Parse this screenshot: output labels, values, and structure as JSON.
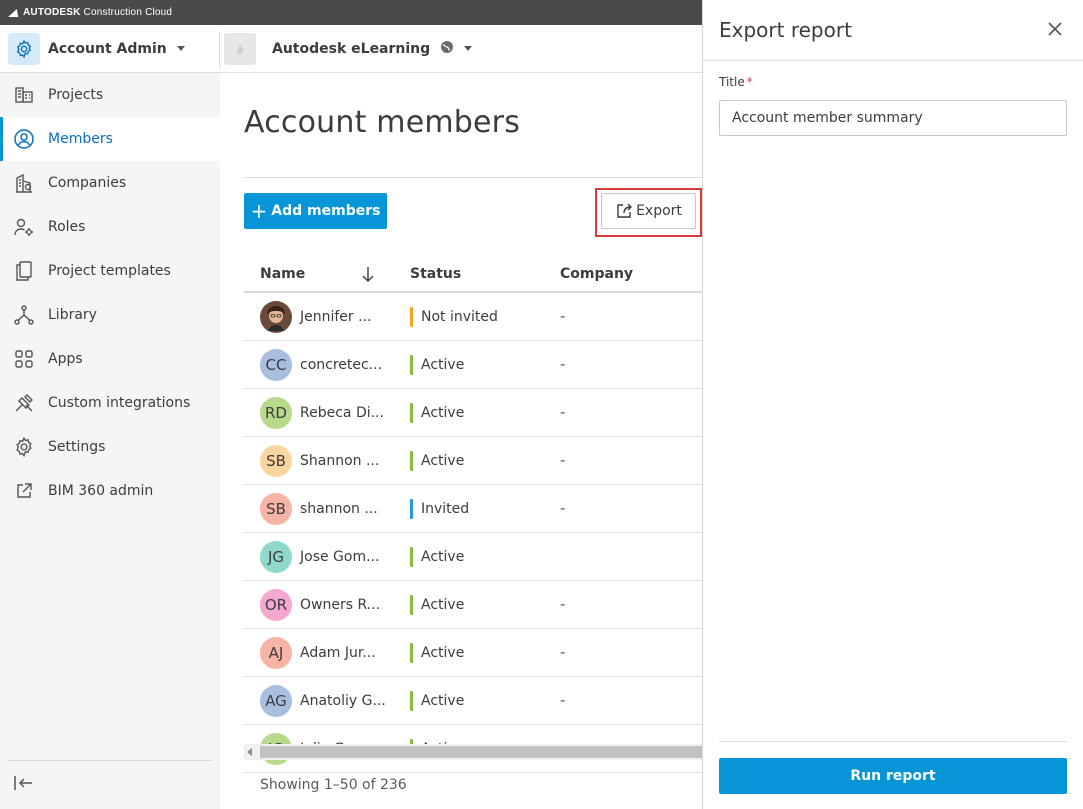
{
  "brand": {
    "name_bold": "AUTODESK",
    "name_rest": "Construction Cloud"
  },
  "header": {
    "account_label": "Account Admin",
    "project_label": "Autodesk eLearning"
  },
  "sidebar": {
    "items": [
      {
        "label": "Projects",
        "icon": "projects-icon"
      },
      {
        "label": "Members",
        "icon": "members-icon",
        "active": true
      },
      {
        "label": "Companies",
        "icon": "companies-icon"
      },
      {
        "label": "Roles",
        "icon": "roles-icon"
      },
      {
        "label": "Project templates",
        "icon": "templates-icon"
      },
      {
        "label": "Library",
        "icon": "library-icon"
      },
      {
        "label": "Apps",
        "icon": "apps-icon"
      },
      {
        "label": "Custom integrations",
        "icon": "integrations-icon"
      },
      {
        "label": "Settings",
        "icon": "settings-icon"
      },
      {
        "label": "BIM 360 admin",
        "icon": "external-link-icon"
      }
    ]
  },
  "main": {
    "title": "Account members",
    "add_label": "Add members",
    "export_label": "Export",
    "columns": {
      "name": "Name",
      "status": "Status",
      "company": "Company"
    },
    "rows": [
      {
        "initials": "",
        "photo": true,
        "name": "Jennifer ...",
        "status": "Not invited",
        "status_color": "#f5a623",
        "company": "-"
      },
      {
        "initials": "CC",
        "avatar_color": "#a8bfe0",
        "name": "concretec...",
        "status": "Active",
        "status_color": "#87bc40",
        "company": "-"
      },
      {
        "initials": "RD",
        "avatar_color": "#b7d98b",
        "name": "Rebeca Di...",
        "status": "Active",
        "status_color": "#87bc40",
        "company": "-"
      },
      {
        "initials": "SB",
        "avatar_color": "#fbd59e",
        "name": "Shannon ...",
        "status": "Active",
        "status_color": "#87bc40",
        "company": "-"
      },
      {
        "initials": "SB",
        "avatar_color": "#f7b4a6",
        "name": "shannon ...",
        "status": "Invited",
        "status_color": "#2a9bd8",
        "company": "-"
      },
      {
        "initials": "JG",
        "avatar_color": "#8fd9cc",
        "name": "Jose Gom...",
        "status": "Active",
        "status_color": "#87bc40",
        "company": ""
      },
      {
        "initials": "OR",
        "avatar_color": "#f5a8cf",
        "name": "Owners R...",
        "status": "Active",
        "status_color": "#87bc40",
        "company": "-"
      },
      {
        "initials": "AJ",
        "avatar_color": "#f7b4a6",
        "name": "Adam Jur...",
        "status": "Active",
        "status_color": "#87bc40",
        "company": "-"
      },
      {
        "initials": "AG",
        "avatar_color": "#a8bfe0",
        "name": "Anatoliy G...",
        "status": "Active",
        "status_color": "#87bc40",
        "company": "-"
      },
      {
        "initials": "JG",
        "avatar_color": "#b7d98b",
        "name": "Julia G...",
        "status": "Active",
        "status_color": "#87bc40",
        "company": ""
      }
    ],
    "showing": "Showing 1–50 of 236"
  },
  "panel": {
    "title": "Export report",
    "field_label": "Title",
    "field_required": "*",
    "field_value": "Account member summary",
    "run_label": "Run report"
  },
  "colors": {
    "accent": "#0696d7",
    "highlight": "#d93b3b"
  }
}
